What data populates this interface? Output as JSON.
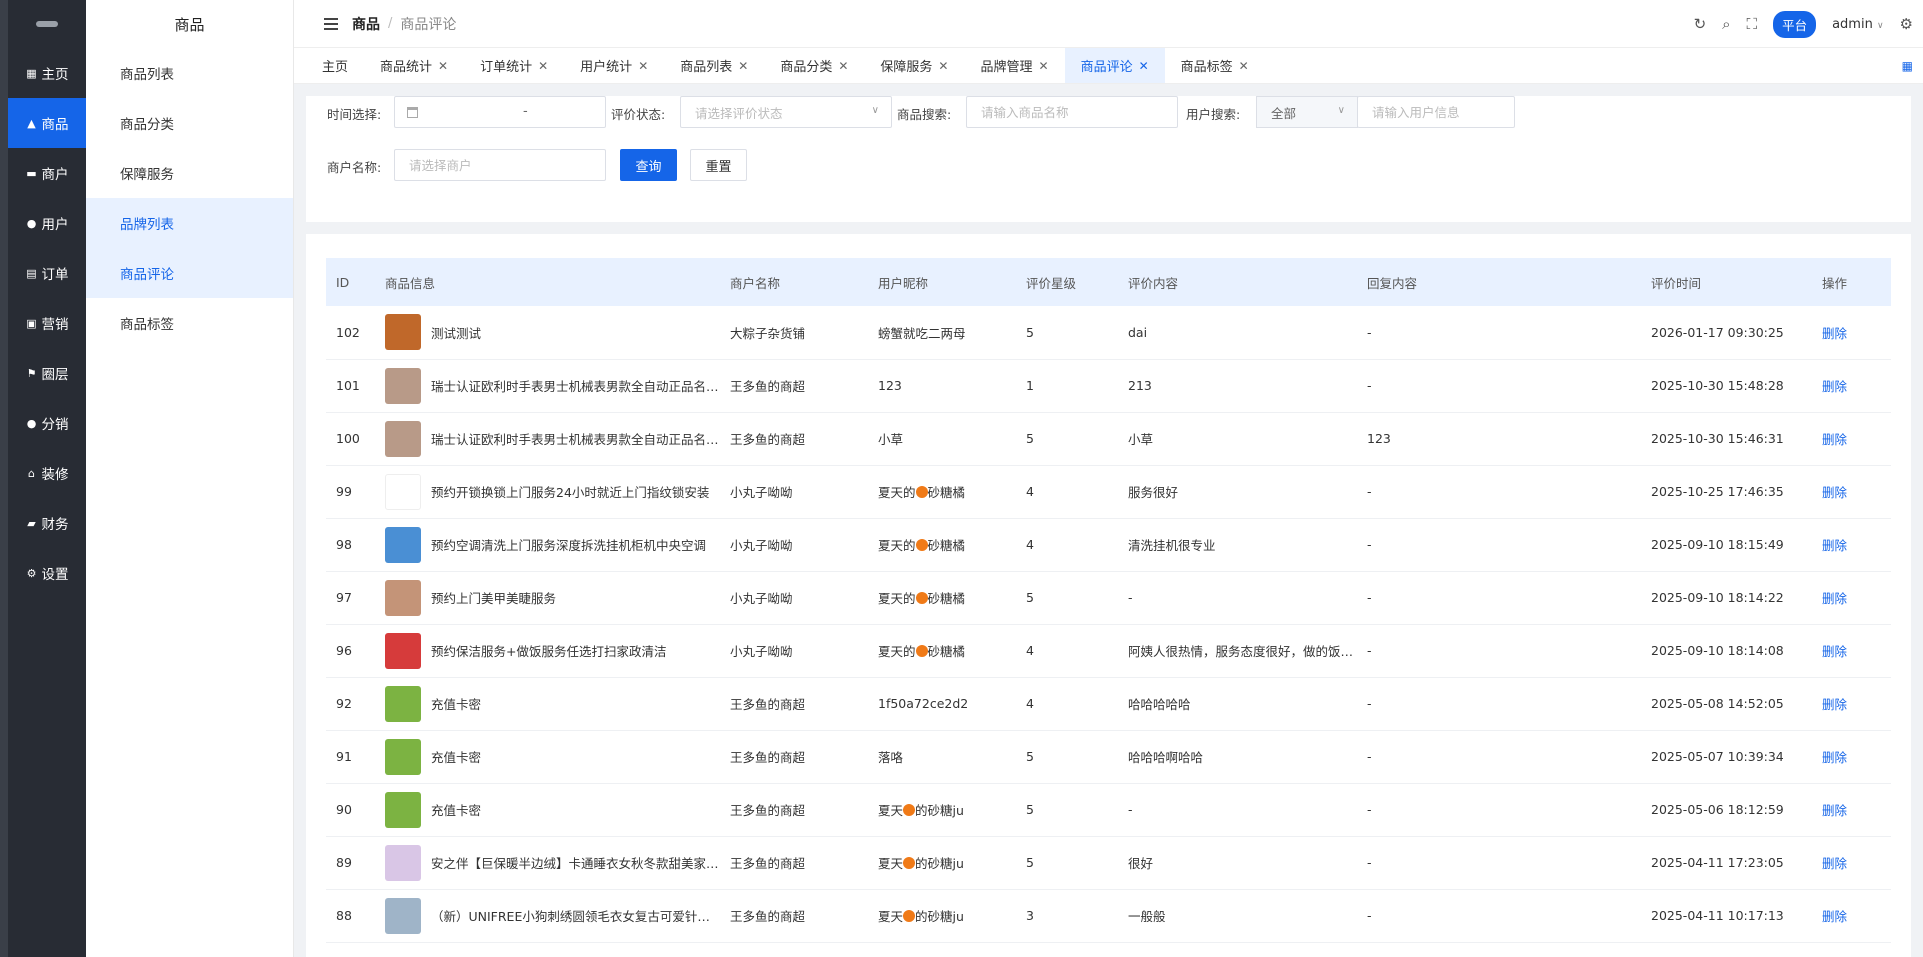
{
  "sidebar": {
    "items": [
      {
        "label": "主页",
        "icon": "grid-icon",
        "glyph": "▦"
      },
      {
        "label": "商品",
        "icon": "bag-icon",
        "glyph": "▲"
      },
      {
        "label": "商户",
        "icon": "store-icon",
        "glyph": "▬"
      },
      {
        "label": "用户",
        "icon": "user-icon",
        "glyph": "●"
      },
      {
        "label": "订单",
        "icon": "order-icon",
        "glyph": "▤"
      },
      {
        "label": "营销",
        "icon": "marketing-icon",
        "glyph": "▣"
      },
      {
        "label": "圈层",
        "icon": "flag-icon",
        "glyph": "⚑"
      },
      {
        "label": "分销",
        "icon": "distribution-icon",
        "glyph": "●"
      },
      {
        "label": "装修",
        "icon": "home-icon",
        "glyph": "⌂"
      },
      {
        "label": "财务",
        "icon": "finance-icon",
        "glyph": "▰"
      },
      {
        "label": "设置",
        "icon": "gear-icon",
        "glyph": "⚙"
      }
    ]
  },
  "subsidebar": {
    "title": "商品",
    "items": [
      "商品列表",
      "商品分类",
      "保障服务",
      "品牌列表",
      "商品评论",
      "商品标签"
    ]
  },
  "header": {
    "crumb_main": "商品",
    "crumb_sub": "商品评论",
    "platform": "平台",
    "user": "admin"
  },
  "tabs": [
    "主页",
    "商品统计",
    "订单统计",
    "用户统计",
    "商品列表",
    "商品分类",
    "保障服务",
    "品牌管理",
    "商品评论",
    "商品标签"
  ],
  "filters": {
    "time_label": "时间选择:",
    "date_sep": "-",
    "status_label": "评价状态:",
    "status_placeholder": "请选择评价状态",
    "product_label": "商品搜索:",
    "product_placeholder": "请输入商品名称",
    "user_label": "用户搜索:",
    "user_type": "全部",
    "user_placeholder": "请输入用户信息",
    "merchant_label": "商户名称:",
    "merchant_placeholder": "请选择商户",
    "query_btn": "查询",
    "reset_btn": "重置"
  },
  "table": {
    "headers": [
      "ID",
      "商品信息",
      "商户名称",
      "用户昵称",
      "评价星级",
      "评价内容",
      "回复内容",
      "评价时间",
      "操作"
    ],
    "action": "删除",
    "rows": [
      {
        "id": "102",
        "product": "测试测试",
        "merchant": "大粽子杂货铺",
        "user": "螃蟹就吃二两母",
        "star": "5",
        "content": "dai",
        "reply": "-",
        "time": "2026-01-17 09:30:25",
        "thumb": "#c0682a"
      },
      {
        "id": "101",
        "product": "瑞士认证欧利时手表男士机械表男款全自动正品名牌时尚",
        "merchant": "王多鱼的商超",
        "user": "123",
        "star": "1",
        "content": "213",
        "reply": "-",
        "time": "2025-10-30 15:48:28",
        "thumb": "#b89a88"
      },
      {
        "id": "100",
        "product": "瑞士认证欧利时手表男士机械表男款全自动正品名牌时尚",
        "merchant": "王多鱼的商超",
        "user": "小草",
        "star": "5",
        "content": "小草",
        "reply": "123",
        "time": "2025-10-30 15:46:31",
        "thumb": "#b89a88"
      },
      {
        "id": "99",
        "product": "预约开锁换锁上门服务24小时就近上门指纹锁安装",
        "merchant": "小丸子呦呦",
        "user_pre": "夏天的",
        "user_post": "砂糖橘",
        "star": "4",
        "content": "服务很好",
        "reply": "-",
        "time": "2025-10-25 17:46:35",
        "thumb": "#ffffff"
      },
      {
        "id": "98",
        "product": "预约空调清洗上门服务深度拆洗挂机柜机中央空调",
        "merchant": "小丸子呦呦",
        "user_pre": "夏天的",
        "user_post": "砂糖橘",
        "star": "4",
        "content": "清洗挂机很专业",
        "reply": "-",
        "time": "2025-09-10 18:15:49",
        "thumb": "#4a8fd4"
      },
      {
        "id": "97",
        "product": "预约上门美甲美睫服务",
        "merchant": "小丸子呦呦",
        "user_pre": "夏天的",
        "user_post": "砂糖橘",
        "star": "5",
        "content": "-",
        "reply": "-",
        "time": "2025-09-10 18:14:22",
        "thumb": "#c49478"
      },
      {
        "id": "96",
        "product": "预约保洁服务+做饭服务任选打扫家政清洁",
        "merchant": "小丸子呦呦",
        "user_pre": "夏天的",
        "user_post": "砂糖橘",
        "star": "4",
        "content": "阿姨人很热情，服务态度很好，做的饭很好吃",
        "reply": "-",
        "time": "2025-09-10 18:14:08",
        "thumb": "#d63b3b"
      },
      {
        "id": "92",
        "product": "充值卡密",
        "merchant": "王多鱼的商超",
        "user": "1f50a72ce2d2",
        "star": "4",
        "content": "哈哈哈哈哈",
        "reply": "-",
        "time": "2025-05-08 14:52:05",
        "thumb": "#7cb342"
      },
      {
        "id": "91",
        "product": "充值卡密",
        "merchant": "王多鱼的商超",
        "user": "落咯",
        "star": "5",
        "content": "哈哈哈啊哈哈",
        "reply": "-",
        "time": "2025-05-07 10:39:34",
        "thumb": "#7cb342"
      },
      {
        "id": "90",
        "product": "充值卡密",
        "merchant": "王多鱼的商超",
        "user_pre": "夏天",
        "user_post": "的砂糖ju",
        "star": "5",
        "content": "-",
        "reply": "-",
        "time": "2025-05-06 18:12:59",
        "thumb": "#7cb342"
      },
      {
        "id": "89",
        "product": "安之伴【巨保暖半边绒】卡通睡衣女秋冬款甜美家居服",
        "merchant": "王多鱼的商超",
        "user_pre": "夏天",
        "user_post": "的砂糖ju",
        "star": "5",
        "content": "很好",
        "reply": "-",
        "time": "2025-04-11 17:23:05",
        "thumb": "#d9c6e6"
      },
      {
        "id": "88",
        "product": "（新）UNIFREE小狗刺绣圆领毛衣女复古可爱针织衫",
        "merchant": "王多鱼的商超",
        "user_pre": "夏天",
        "user_post": "的砂糖ju",
        "star": "3",
        "content": "一般般",
        "reply": "-",
        "time": "2025-04-11 10:17:13",
        "thumb": "#9fb4c8"
      }
    ]
  }
}
